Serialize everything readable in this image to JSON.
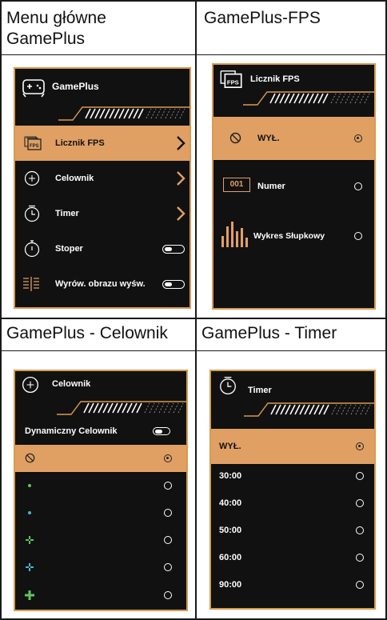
{
  "cells": {
    "main": {
      "title": "Menu główne GamePlus"
    },
    "fps": {
      "title": "GamePlus-FPS"
    },
    "crosshair": {
      "title": "GamePlus - Celownik"
    },
    "timer": {
      "title": "GamePlus - Timer"
    }
  },
  "main_panel": {
    "header": "GamePlus",
    "items": [
      {
        "label": "Licznik FPS",
        "icon": "fps-icon",
        "control": "chevron"
      },
      {
        "label": "Celownik",
        "icon": "crosshair-icon",
        "control": "chevron"
      },
      {
        "label": "Timer",
        "icon": "timer-icon",
        "control": "chevron"
      },
      {
        "label": "Stoper",
        "icon": "stopwatch-icon",
        "control": "toggle"
      },
      {
        "label": "Wyrów. obrazu wyśw.",
        "icon": "align-icon",
        "control": "toggle"
      }
    ]
  },
  "fps_panel": {
    "header": "Licznik FPS",
    "items": [
      {
        "label": "WYŁ.",
        "icon": "off-icon"
      },
      {
        "label": "Numer",
        "badge": "001"
      },
      {
        "label": "Wykres Słupkowy",
        "icon": "bar-graph-icon"
      }
    ]
  },
  "crosshair_panel": {
    "header": "Celownik",
    "dynamic_label": "Dynamiczny Celownik",
    "items": [
      "off",
      "green-dot",
      "cyan-dot",
      "green-cross-small",
      "cyan-cross",
      "green-cross-large"
    ]
  },
  "timer_panel": {
    "header": "Timer",
    "items": [
      "WYŁ.",
      "30:00",
      "40:00",
      "50:00",
      "60:00",
      "90:00"
    ]
  },
  "colors": {
    "accent": "#e0a064",
    "border": "#d99a4e",
    "panel": "#111111",
    "green": "#5cc85a",
    "cyan": "#44b6d6"
  }
}
